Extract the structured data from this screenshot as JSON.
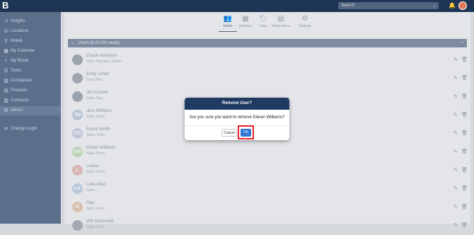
{
  "topbar": {
    "logo": "B",
    "search_placeholder": "Search",
    "search_chevron": "⌄",
    "bell": "🔔"
  },
  "sidebar": {
    "items": [
      {
        "icon": "↗",
        "label": "Insights"
      },
      {
        "icon": "⦿",
        "label": "Locations"
      },
      {
        "icon": "⚲",
        "label": "Hotels"
      },
      {
        "icon": "▦",
        "label": "My Calendar"
      },
      {
        "icon": "⑂",
        "label": "My Route"
      },
      {
        "icon": "☰",
        "label": "Tasks"
      },
      {
        "icon": "▥",
        "label": "Companies"
      },
      {
        "icon": "▤",
        "label": "Products"
      },
      {
        "icon": "▧",
        "label": "Contracts"
      },
      {
        "icon": "⚙",
        "label": "Admin"
      },
      {
        "icon": "⇄",
        "label": "Change Login"
      }
    ]
  },
  "tabs": [
    {
      "icon": "👥",
      "label": "Users"
    },
    {
      "icon": "▦",
      "label": "Regions"
    },
    {
      "icon": "🏷",
      "label": "Tags"
    },
    {
      "icon": "▤",
      "label": "Integrations"
    },
    {
      "icon": "⚙",
      "label": "Settings"
    }
  ],
  "section": {
    "chevron": "⌄",
    "title": "Users (9 of 100 seats)",
    "plus": "+"
  },
  "users": [
    {
      "initial": "",
      "name": "Chuck Norwood",
      "sub": "Sales Manager, Admin",
      "color": "#9aa2ab"
    },
    {
      "initial": "",
      "name": "Emily Jones",
      "sub": "Sales Rep",
      "color": "#a0a7b0"
    },
    {
      "initial": "",
      "name": "Jim Kramer",
      "sub": "Sales Rep",
      "color": "#9ba3ac"
    },
    {
      "initial": "JW",
      "name": "Jess Williams",
      "sub": "Sales Team",
      "color": "#b8c4d2"
    },
    {
      "initial": "GS",
      "name": "Grace Smith",
      "sub": "Sales Team",
      "color": "#c0c5d8"
    },
    {
      "initial": "KW",
      "name": "Kieran Williams",
      "sub": "Sales Team",
      "color": "#b9d3b7"
    },
    {
      "initial": "L",
      "name": "Louise",
      "sub": "Sales Team",
      "color": "#d9b7b7"
    },
    {
      "initial": "LA",
      "name": "Luke Allen",
      "sub": "Sales",
      "color": "#b7c9da"
    },
    {
      "initial": "R",
      "name": "Ray",
      "sub": "Sales Team",
      "color": "#d8c0b0"
    },
    {
      "initial": "",
      "name": "Will McDonald",
      "sub": "Sales Team",
      "color": "#a2a9b2"
    }
  ],
  "modal": {
    "title": "Remove User?",
    "message": "Are you sure you want to remove Kieran Williams?",
    "cancel_label": "Cancel",
    "ok_label": "OK"
  }
}
